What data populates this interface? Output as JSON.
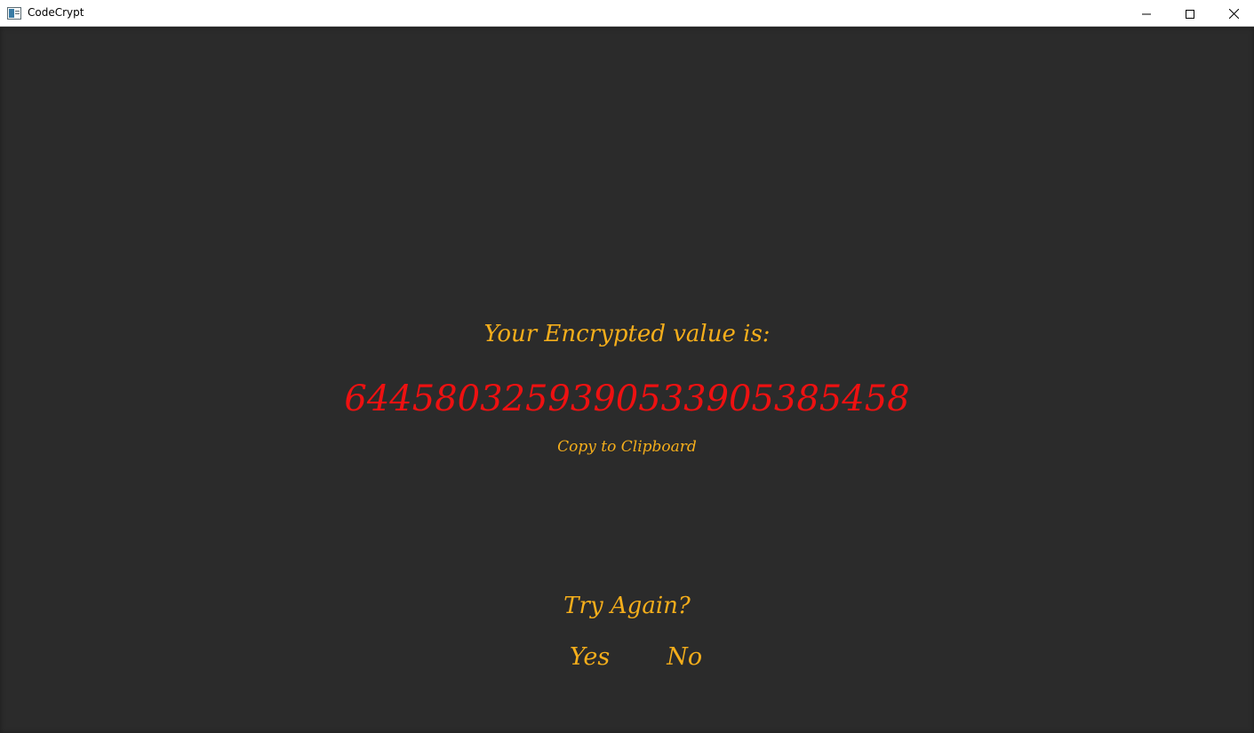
{
  "window": {
    "title": "CodeCrypt",
    "controls": {
      "minimize_icon": "minimize-icon",
      "maximize_icon": "maximize-icon",
      "close_icon": "close-icon"
    }
  },
  "main": {
    "heading": "Your Encrypted value is:",
    "encrypted_value": "6445803259390533905385458",
    "copy_label": "Copy to Clipboard",
    "try_again_label": "Try Again?",
    "yes_label": "Yes",
    "no_label": "No"
  },
  "colors": {
    "background": "#2b2b2b",
    "accent": "#f5ae1b",
    "value": "#ee1111",
    "titlebar": "#ffffff"
  }
}
